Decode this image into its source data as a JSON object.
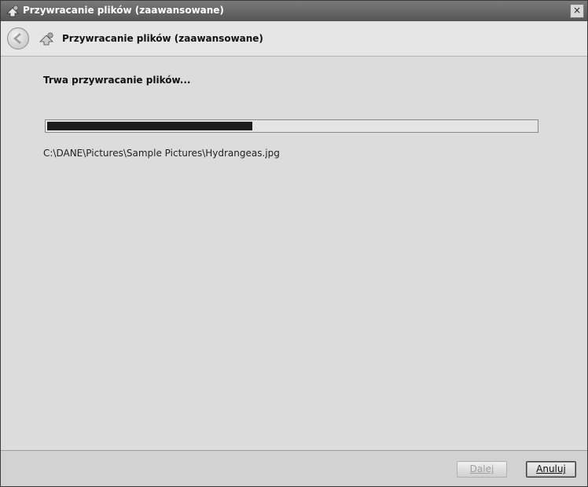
{
  "window": {
    "title": "Przywracanie plików (zaawansowane)",
    "close_glyph": "×"
  },
  "nav": {
    "title": "Przywracanie plików (zaawansowane)",
    "back_icon": "back-arrow-icon",
    "wizard_icon": "restore-files-icon"
  },
  "main": {
    "heading": "Trwa przywracanie plików...",
    "progress": 0.42,
    "current_file": "C:\\DANE\\Pictures\\Sample Pictures\\Hydrangeas.jpg"
  },
  "footer": {
    "next_label": "Dalej",
    "cancel_label": "Anuluj"
  },
  "colors": {
    "progress_fill": "#1c1c1c",
    "window_bg": "#dcdcdc"
  }
}
